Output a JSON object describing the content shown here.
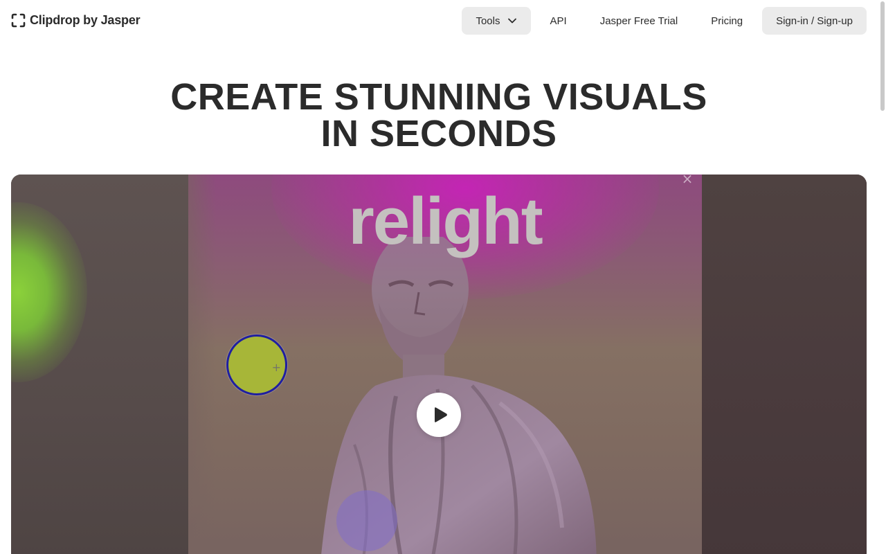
{
  "header": {
    "logo_text": "Clipdrop by Jasper",
    "logo_icon": "clipdrop-bracket-icon",
    "nav": {
      "tools_label": "Tools",
      "api_label": "API",
      "jasper_trial_label": "Jasper Free Trial",
      "pricing_label": "Pricing",
      "signin_label": "Sign-in / Sign-up"
    }
  },
  "hero": {
    "title_line1": "CREATE STUNNING VISUALS",
    "title_line2": "IN SECONDS"
  },
  "video": {
    "overlay_text": "relight",
    "close_symbol": "×",
    "handle_symbol": "+",
    "play_icon": "play-icon"
  },
  "colors": {
    "text": "#2b2b2b",
    "button_bg": "#ebebeb",
    "light_handle_fill": "#a7b638",
    "light_handle_border": "#1f1fa0",
    "magenta_light": "#cd1ebe",
    "green_light": "#8bd13a"
  }
}
